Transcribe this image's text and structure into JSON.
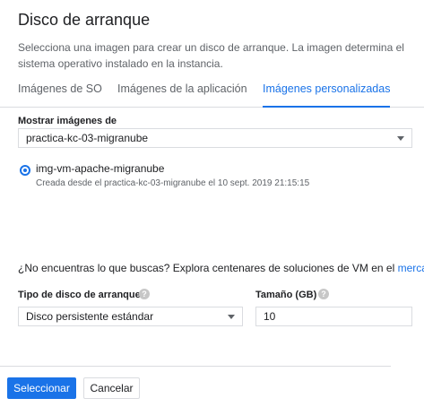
{
  "dialog": {
    "title": "Disco de arranque",
    "description": "Selecciona una imagen para crear un disco de arranque. La imagen determina el sistema operativo instalado en la instancia."
  },
  "tabs": [
    {
      "label": "Imágenes de SO",
      "active": false
    },
    {
      "label": "Imágenes de la aplicación",
      "active": false
    },
    {
      "label": "Imágenes personalizadas",
      "active": true
    }
  ],
  "project_filter": {
    "label": "Mostrar imágenes de",
    "selected": "practica-kc-03-migranube"
  },
  "image_option": {
    "name": "img-vm-apache-migranube",
    "subtitle": "Creada desde el practica-kc-03-migranube el 10 sept. 2019 21:15:15",
    "selected": true
  },
  "not_found": {
    "text": "¿No encuentras lo que buscas? Explora centenares de soluciones de VM en el ",
    "link": "merca"
  },
  "disk_type": {
    "label": "Tipo de disco de arranque",
    "selected": "Disco persistente estándar",
    "help": "?"
  },
  "disk_size": {
    "label": "Tamaño (GB)",
    "value": "10",
    "help": "?"
  },
  "actions": {
    "select_label": "Seleccionar",
    "cancel_label": "Cancelar"
  },
  "colors": {
    "accent": "#1a73e8",
    "text": "#202124",
    "muted": "#5f6368",
    "border": "#dadce0"
  }
}
